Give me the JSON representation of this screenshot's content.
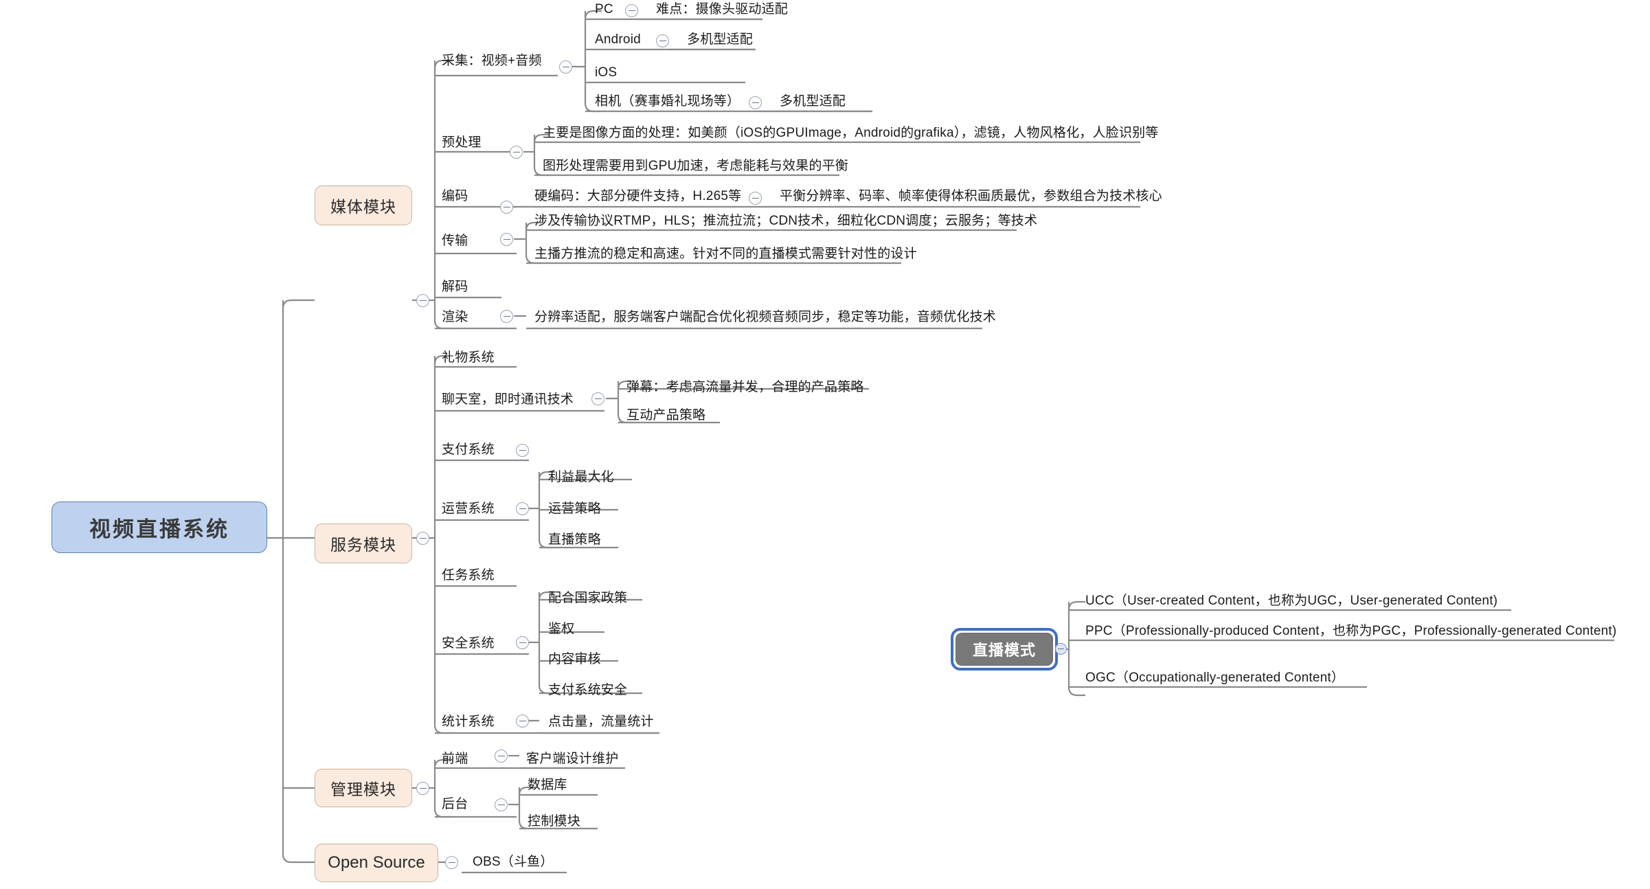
{
  "diagram": {
    "title": "视频直播系统",
    "type": "mindmap",
    "background": "#ffffff",
    "colors": {
      "root_fill": "#bed2f0",
      "root_border": "#5d7fa8",
      "module_fill": "#fbeade",
      "module_border": "#cbb49f",
      "selected_fill": "#787878",
      "selection_ring": "#3f6fc0",
      "connector": "#8a8a8a",
      "text": "#1b1b1b"
    }
  },
  "root": {
    "label": "视频直播系统"
  },
  "modules": [
    {
      "label": "媒体模块"
    },
    {
      "label": "服务模块"
    },
    {
      "label": "管理模块"
    },
    {
      "label": "Open Source"
    }
  ],
  "media": {
    "capture": {
      "label": "采集：视频+音频",
      "children": [
        {
          "label": "PC",
          "detail": "难点：摄像头驱动适配"
        },
        {
          "label": "Android",
          "detail": "多机型适配"
        },
        {
          "label": "iOS",
          "detail": ""
        },
        {
          "label": "相机（赛事婚礼现场等）",
          "detail": "多机型适配"
        }
      ]
    },
    "preprocess": {
      "label": "预处理",
      "children": [
        {
          "label": "主要是图像方面的处理：如美颜（iOS的GPUImage，Android的grafika），滤镜，人物风格化，人脸识别等"
        },
        {
          "label": "图形处理需要用到GPU加速，考虑能耗与效果的平衡"
        }
      ]
    },
    "encode": {
      "label": "编码",
      "child": "硬编码：大部分硬件支持，H.265等",
      "grandchild": "平衡分辨率、码率、帧率使得体积画质最优，参数组合为技术核心"
    },
    "transport": {
      "label": "传输",
      "children": [
        {
          "label": "涉及传输协议RTMP，HLS；推流拉流；CDN技术，细粒化CDN调度；云服务；等技术"
        },
        {
          "label": "主播方推流的稳定和高速。针对不同的直播模式需要针对性的设计"
        }
      ]
    },
    "decode": {
      "label": "解码"
    },
    "render": {
      "label": "渲染",
      "detail": "分辨率适配，服务端客户端配合优化视频音频同步，稳定等功能，音频优化技术"
    }
  },
  "service": {
    "gift": {
      "label": "礼物系统"
    },
    "chat": {
      "label": "聊天室，即时通讯技术",
      "children": [
        {
          "label": "弹幕：考虑高流量并发，合理的产品策略"
        },
        {
          "label": "互动产品策略"
        }
      ]
    },
    "payment": {
      "label": "支付系统"
    },
    "operation": {
      "label": "运营系统",
      "children": [
        {
          "label": "利益最大化"
        },
        {
          "label": "运营策略"
        },
        {
          "label": "直播策略"
        }
      ]
    },
    "task": {
      "label": "任务系统"
    },
    "security": {
      "label": "安全系统",
      "children": [
        {
          "label": "配合国家政策"
        },
        {
          "label": "鉴权"
        },
        {
          "label": "内容审核"
        },
        {
          "label": "支付系统安全"
        }
      ]
    },
    "stats": {
      "label": "统计系统",
      "detail": "点击量，流量统计"
    }
  },
  "management": {
    "frontend": {
      "label": "前端",
      "detail": "客户端设计维护"
    },
    "backend": {
      "label": "后台",
      "children": [
        {
          "label": "数据库"
        },
        {
          "label": "控制模块"
        }
      ]
    }
  },
  "opensource": {
    "child": {
      "label": "OBS（斗鱼）"
    }
  },
  "live_mode": {
    "label": "直播模式",
    "selected": true,
    "children": [
      {
        "label": "UCC（User-created Content，也称为UGC，User-generated Content)"
      },
      {
        "label": "PPC（Professionally-produced Content，也称为PGC，Professionally-generated Content)"
      },
      {
        "label": "OGC（Occupationally-generated Content）"
      }
    ]
  }
}
